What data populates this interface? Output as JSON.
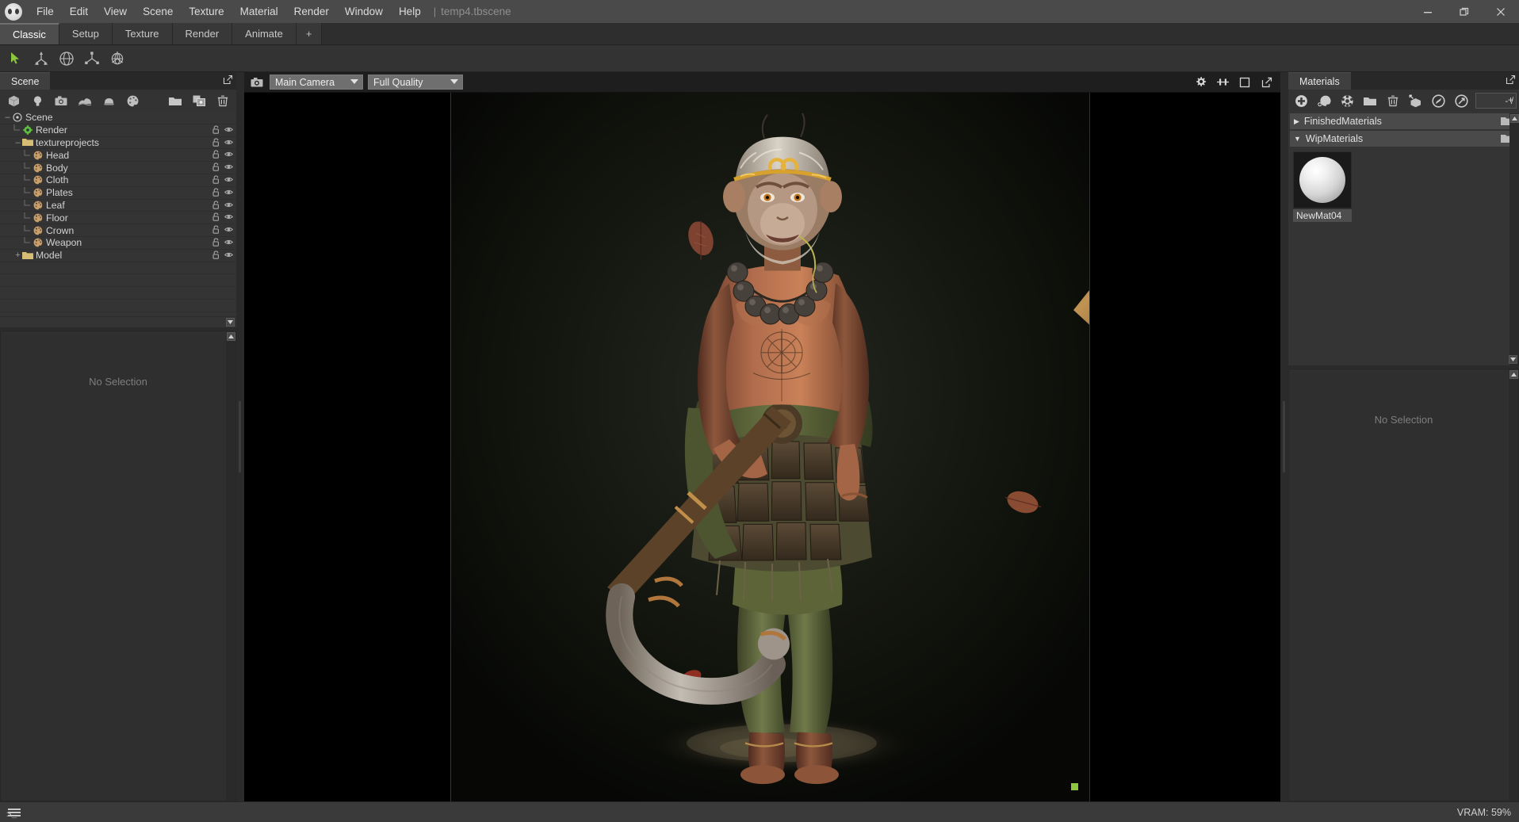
{
  "window": {
    "title": "temp4.tbscene",
    "separator": "|",
    "controls": [
      {
        "name": "minimize-button",
        "glyph": "—"
      },
      {
        "name": "restore-button",
        "glyph": "❐"
      },
      {
        "name": "close-button",
        "glyph": "✕"
      }
    ]
  },
  "menubar": {
    "logo_name": "marmoset-toolbag-logo",
    "items": [
      "File",
      "Edit",
      "View",
      "Scene",
      "Texture",
      "Material",
      "Render",
      "Window",
      "Help"
    ]
  },
  "layout_tabs": {
    "items": [
      "Classic",
      "Setup",
      "Texture",
      "Render",
      "Animate"
    ],
    "active": "Classic",
    "add_label": "+"
  },
  "toolstrip": {
    "tools": [
      {
        "name": "select-cursor-tool",
        "label": "Select"
      },
      {
        "name": "translate-gizmo-tool",
        "label": "Translate"
      },
      {
        "name": "rotate-gizmo-tool",
        "label": "Rotate"
      },
      {
        "name": "scale-gizmo-tool",
        "label": "Scale"
      },
      {
        "name": "transform-gizmo-tool",
        "label": "Transform"
      }
    ]
  },
  "scene_panel": {
    "tab_label": "Scene",
    "toolbar": [
      {
        "name": "add-mesh-button",
        "label": "Add Mesh"
      },
      {
        "name": "add-light-button",
        "label": "Add Light"
      },
      {
        "name": "add-camera-button",
        "label": "Add Camera"
      },
      {
        "name": "add-sky-button",
        "label": "Add Sky"
      },
      {
        "name": "add-fog-button",
        "label": "Add Fog"
      },
      {
        "name": "add-material-button",
        "label": "Add Material"
      },
      {
        "name": "new-folder-button",
        "label": "New Folder"
      },
      {
        "name": "duplicate-button",
        "label": "Duplicate"
      },
      {
        "name": "delete-button",
        "label": "Delete"
      }
    ],
    "tree": [
      {
        "label": "Scene",
        "depth": 0,
        "icon": "scene-icon",
        "expander": "minus",
        "row_icons": false
      },
      {
        "label": "Render",
        "depth": 1,
        "icon": "render-icon",
        "expander": "none",
        "row_icons": true
      },
      {
        "label": "textureprojects",
        "depth": 1,
        "icon": "folder-icon",
        "expander": "minus",
        "row_icons": true
      },
      {
        "label": "Head",
        "depth": 2,
        "icon": "material-icon",
        "expander": "none",
        "row_icons": true
      },
      {
        "label": "Body",
        "depth": 2,
        "icon": "material-icon",
        "expander": "none",
        "row_icons": true
      },
      {
        "label": "Cloth",
        "depth": 2,
        "icon": "material-icon",
        "expander": "none",
        "row_icons": true
      },
      {
        "label": "Plates",
        "depth": 2,
        "icon": "material-icon",
        "expander": "none",
        "row_icons": true
      },
      {
        "label": "Leaf",
        "depth": 2,
        "icon": "material-icon",
        "expander": "none",
        "row_icons": true
      },
      {
        "label": "Floor",
        "depth": 2,
        "icon": "material-icon",
        "expander": "none",
        "row_icons": true
      },
      {
        "label": "Crown",
        "depth": 2,
        "icon": "material-icon",
        "expander": "none",
        "row_icons": true
      },
      {
        "label": "Weapon",
        "depth": 2,
        "icon": "material-icon",
        "expander": "none",
        "row_icons": true
      },
      {
        "label": "Model",
        "depth": 1,
        "icon": "folder-icon",
        "expander": "plus",
        "row_icons": true
      }
    ]
  },
  "properties_panel": {
    "empty_label": "No Selection"
  },
  "viewport": {
    "camera_select": "Main Camera",
    "quality_select": "Full Quality",
    "camera_options": [
      "Main Camera"
    ],
    "quality_options": [
      "Full Quality"
    ],
    "buttons": [
      {
        "name": "viewport-settings-gear-icon",
        "label": "Settings"
      },
      {
        "name": "viewport-split-icon",
        "label": "Split View"
      },
      {
        "name": "viewport-frame-icon",
        "label": "Frame"
      },
      {
        "name": "viewport-popout-icon",
        "label": "Pop Out"
      }
    ],
    "render_indicator_color": "#8cc63f"
  },
  "materials_panel": {
    "tab_label": "Materials",
    "toolbar": [
      {
        "name": "new-material-button",
        "label": "New Material"
      },
      {
        "name": "duplicate-material-button",
        "label": "Duplicate Material"
      },
      {
        "name": "clear-material-button",
        "label": "Clear Material"
      },
      {
        "name": "material-folder-button",
        "label": "New Folder"
      },
      {
        "name": "delete-material-button",
        "label": "Delete"
      },
      {
        "name": "assign-material-button",
        "label": "Assign to Selection"
      },
      {
        "name": "select-by-material-button",
        "label": "Select by Material"
      },
      {
        "name": "material-link-button",
        "label": "Material Link"
      }
    ],
    "counter_value": "- /",
    "counter_plus": "+",
    "groups": [
      {
        "name": "FinishedMaterials",
        "expanded": false,
        "items": []
      },
      {
        "name": "WipMaterials",
        "expanded": true,
        "items": [
          {
            "label": "NewMat04",
            "thumb": "sphere-preview"
          }
        ]
      }
    ],
    "empty_label": "No Selection"
  },
  "statusbar": {
    "menu_icon": "hamburger-icon",
    "prompt": ">_",
    "vram": "VRAM: 59%"
  },
  "colors": {
    "accent_green": "#8cc63f",
    "menubar_bg": "#4a4a4a",
    "panel_bg": "#343434",
    "active_tab": "#4d4d4d"
  }
}
